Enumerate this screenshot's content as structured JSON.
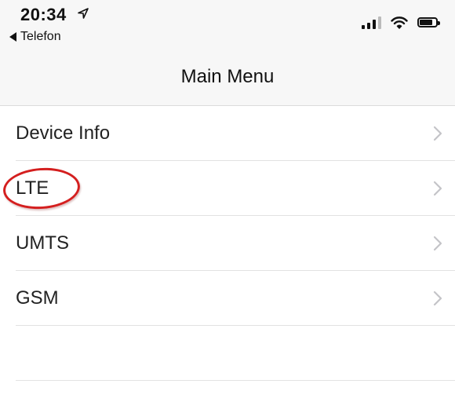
{
  "status_bar": {
    "time": "20:34",
    "back_label": "Telefon",
    "battery_level_fraction": 0.8
  },
  "nav": {
    "title": "Main Menu"
  },
  "menu": {
    "items": [
      {
        "label": "Device Info"
      },
      {
        "label": "LTE"
      },
      {
        "label": "UMTS"
      },
      {
        "label": "GSM"
      }
    ]
  },
  "annotation": {
    "color": "#d41f1f",
    "target": "LTE"
  },
  "icons": {
    "location": "location-arrow-icon",
    "back": "back-triangle-icon",
    "signal": "cellular-signal-icon",
    "wifi": "wifi-icon",
    "battery": "battery-icon",
    "chevron": "chevron-right-icon"
  }
}
